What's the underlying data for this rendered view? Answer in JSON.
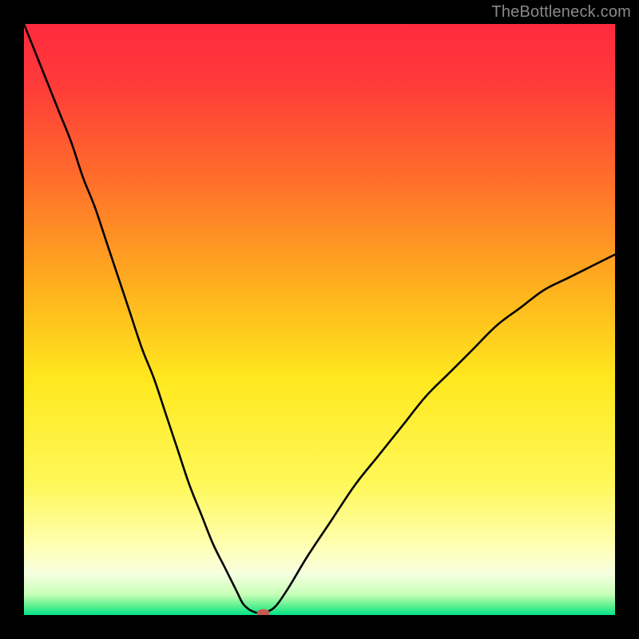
{
  "watermark": "TheBottleneck.com",
  "chart_data": {
    "type": "line",
    "title": "",
    "xlabel": "",
    "ylabel": "",
    "xlim": [
      0,
      100
    ],
    "ylim": [
      0,
      100
    ],
    "gradient_stops": [
      {
        "offset": 0.0,
        "color": "#ff2a3f"
      },
      {
        "offset": 0.1,
        "color": "#ff3a3a"
      },
      {
        "offset": 0.25,
        "color": "#ff6a2c"
      },
      {
        "offset": 0.45,
        "color": "#ffb21e"
      },
      {
        "offset": 0.6,
        "color": "#ffe81e"
      },
      {
        "offset": 0.78,
        "color": "#fff85a"
      },
      {
        "offset": 0.88,
        "color": "#ffffb0"
      },
      {
        "offset": 0.93,
        "color": "#f6ffe0"
      },
      {
        "offset": 0.965,
        "color": "#c8ffb8"
      },
      {
        "offset": 0.985,
        "color": "#5cf08e"
      },
      {
        "offset": 1.0,
        "color": "#00e38a"
      }
    ],
    "series": [
      {
        "name": "bottleneck-curve",
        "x": [
          0,
          2,
          4,
          6,
          8,
          10,
          12,
          14,
          16,
          18,
          20,
          22,
          24,
          26,
          28,
          30,
          32,
          34,
          36,
          37,
          38,
          39,
          40,
          41,
          42,
          43,
          45,
          48,
          52,
          56,
          60,
          64,
          68,
          72,
          76,
          80,
          84,
          88,
          92,
          96,
          100
        ],
        "y": [
          100,
          95,
          90,
          85,
          80,
          74,
          69,
          63,
          57,
          51,
          45,
          40,
          34,
          28,
          22,
          17,
          12,
          8,
          4,
          2,
          1,
          0.5,
          0.3,
          0.5,
          1,
          2,
          5,
          10,
          16,
          22,
          27,
          32,
          37,
          41,
          45,
          49,
          52,
          55,
          57,
          59,
          61
        ]
      }
    ],
    "marker": {
      "x": 40.5,
      "y": 0.3,
      "color": "#c65a4f"
    }
  }
}
